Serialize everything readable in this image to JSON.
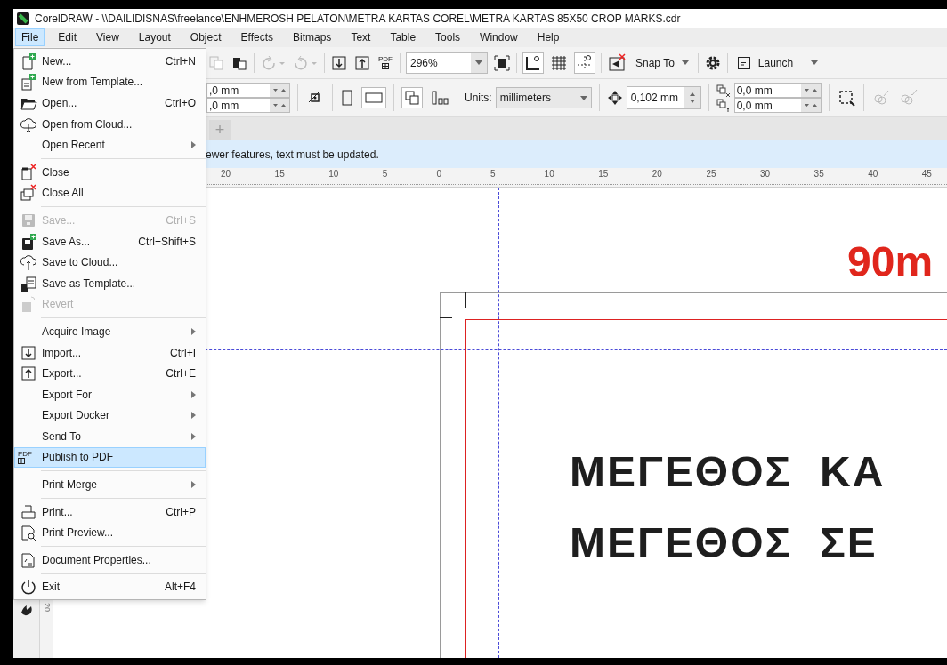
{
  "window": {
    "title": "CorelDRAW - \\\\DAILIDISNAS\\freelance\\ENHMEROSH PELATON\\METRA KARTAS COREL\\METRA KARTAS 85X50 CROP MARKS.cdr"
  },
  "menubar": [
    {
      "label": "File",
      "selected": true
    },
    {
      "label": "Edit",
      "selected": false
    },
    {
      "label": "View",
      "selected": false
    },
    {
      "label": "Layout",
      "selected": false
    },
    {
      "label": "Object",
      "selected": false
    },
    {
      "label": "Effects",
      "selected": false
    },
    {
      "label": "Bitmaps",
      "selected": false
    },
    {
      "label": "Text",
      "selected": false
    },
    {
      "label": "Table",
      "selected": false
    },
    {
      "label": "Tools",
      "selected": false
    },
    {
      "label": "Window",
      "selected": false
    },
    {
      "label": "Help",
      "selected": false
    }
  ],
  "toolbar": {
    "pdf_label": "PDF",
    "zoom": "296%",
    "snap": "Snap To",
    "launch": "Launch"
  },
  "property_bar": {
    "width": ",0 mm",
    "height": ",0 mm",
    "units_label": "Units:",
    "units": "millimeters",
    "nudge": "0,102 mm",
    "dup_x": "0,0 mm",
    "dup_y": "0,0 mm"
  },
  "tab_row": {
    "add": "+"
  },
  "info_bar": {
    "text": "ewer features, text must be updated."
  },
  "ruler": {
    "labels": [
      "20",
      "15",
      "10",
      "5",
      "0",
      "5",
      "10",
      "15",
      "20",
      "25",
      "30",
      "35",
      "40",
      "45"
    ],
    "vertical_label": "20"
  },
  "canvas": {
    "size_text": "90m",
    "lines": [
      "ΜΕΓΕΘΟΣ  ΚΑ",
      "ΜΕΓΕΘΟΣ  ΣΕ"
    ]
  },
  "file_menu": [
    {
      "label": "New...",
      "shortcut": "Ctrl+N",
      "submenu": false,
      "disabled": false,
      "selected": false,
      "separator_before": false
    },
    {
      "label": "New from Template...",
      "submenu": false,
      "disabled": false,
      "selected": false,
      "separator_before": false
    },
    {
      "label": "Open...",
      "shortcut": "Ctrl+O",
      "submenu": false,
      "disabled": false,
      "selected": false,
      "separator_before": false
    },
    {
      "label": "Open from Cloud...",
      "submenu": false,
      "disabled": false,
      "selected": false,
      "separator_before": false
    },
    {
      "label": "Open Recent",
      "submenu": true,
      "disabled": false,
      "selected": false,
      "separator_before": false
    },
    {
      "label": "Close",
      "submenu": false,
      "disabled": false,
      "selected": false,
      "separator_before": true
    },
    {
      "label": "Close All",
      "submenu": false,
      "disabled": false,
      "selected": false,
      "separator_before": false
    },
    {
      "label": "Save...",
      "shortcut": "Ctrl+S",
      "submenu": false,
      "disabled": true,
      "selected": false,
      "separator_before": true
    },
    {
      "label": "Save As...",
      "shortcut": "Ctrl+Shift+S",
      "submenu": false,
      "disabled": false,
      "selected": false,
      "separator_before": false
    },
    {
      "label": "Save to Cloud...",
      "submenu": false,
      "disabled": false,
      "selected": false,
      "separator_before": false
    },
    {
      "label": "Save as Template...",
      "submenu": false,
      "disabled": false,
      "selected": false,
      "separator_before": false
    },
    {
      "label": "Revert",
      "submenu": false,
      "disabled": true,
      "selected": false,
      "separator_before": false
    },
    {
      "label": "Acquire Image",
      "submenu": true,
      "disabled": false,
      "selected": false,
      "separator_before": true
    },
    {
      "label": "Import...",
      "shortcut": "Ctrl+I",
      "submenu": false,
      "disabled": false,
      "selected": false,
      "separator_before": false
    },
    {
      "label": "Export...",
      "shortcut": "Ctrl+E",
      "submenu": false,
      "disabled": false,
      "selected": false,
      "separator_before": false
    },
    {
      "label": "Export For",
      "submenu": true,
      "disabled": false,
      "selected": false,
      "separator_before": false
    },
    {
      "label": "Export Docker",
      "submenu": true,
      "disabled": false,
      "selected": false,
      "separator_before": false
    },
    {
      "label": "Send To",
      "submenu": true,
      "disabled": false,
      "selected": false,
      "separator_before": false
    },
    {
      "label": "Publish to PDF",
      "icon_text": "PDF",
      "submenu": false,
      "disabled": false,
      "selected": true,
      "separator_before": false
    },
    {
      "label": "Print Merge",
      "submenu": true,
      "disabled": false,
      "selected": false,
      "separator_before": true
    },
    {
      "label": "Print...",
      "shortcut": "Ctrl+P",
      "submenu": false,
      "disabled": false,
      "selected": false,
      "separator_before": true
    },
    {
      "label": "Print Preview...",
      "submenu": false,
      "disabled": false,
      "selected": false,
      "separator_before": false
    },
    {
      "label": "Document Properties...",
      "submenu": false,
      "disabled": false,
      "selected": false,
      "separator_before": true
    },
    {
      "label": "Exit",
      "shortcut": "Alt+F4",
      "submenu": false,
      "disabled": false,
      "selected": false,
      "separator_before": true
    }
  ]
}
